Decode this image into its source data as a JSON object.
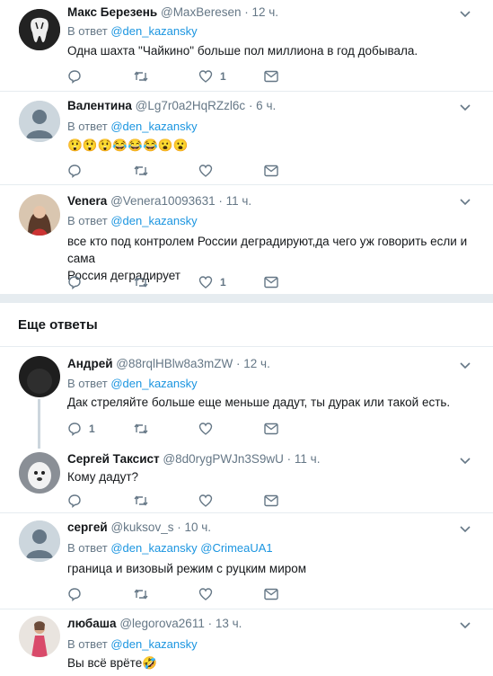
{
  "reply_prefix": "В ответ",
  "section_title": "Еще ответы",
  "tweets": [
    {
      "name": "Макс Березень",
      "handle": "@MaxBeresen",
      "time": "· 12 ч.",
      "reply_to": [
        "@den_kazansky"
      ],
      "text": [
        "Одна шахта \"Чайкино\" больше пол миллиона в год добывала."
      ],
      "reply_count": "",
      "like_count": "1",
      "avatar": "tooth-logo"
    },
    {
      "name": "Валентина",
      "handle": "@Lg7r0a2HqRZzl6c",
      "time": "· 6 ч.",
      "reply_to": [
        "@den_kazansky"
      ],
      "text": [
        "😲😲😲😂😂😂😮😮"
      ],
      "reply_count": "",
      "like_count": "",
      "avatar": "default"
    },
    {
      "name": "Venera",
      "handle": "@Venera10093631",
      "time": "· 11 ч.",
      "reply_to": [
        "@den_kazansky"
      ],
      "text": [
        "все кто под контролем России деградируют,да чего уж говорить если и сама",
        "Россия деградирует"
      ],
      "reply_count": "",
      "like_count": "1",
      "avatar": "photo-woman"
    },
    {
      "name": "Андрей",
      "handle": "@88rqlHBlw8a3mZW",
      "time": "· 12 ч.",
      "reply_to": [
        "@den_kazansky"
      ],
      "text": [
        "Дак стреляйте больше еще меньше дадут, ты дурак или такой есть."
      ],
      "reply_count": "1",
      "like_count": "",
      "avatar": "dark-photo"
    },
    {
      "name": "Сергей Таксист",
      "handle": "@8d0rygPWJn3S9wU",
      "time": "· 11 ч.",
      "reply_to": [],
      "text": [
        "Кому дадут?"
      ],
      "reply_count": "",
      "like_count": "",
      "avatar": "dog-photo"
    },
    {
      "name": "сергей",
      "handle": "@kuksov_s",
      "time": "· 10 ч.",
      "reply_to": [
        "@den_kazansky",
        "@CrimeaUA1"
      ],
      "text": [
        "граница и визовый режим с руцким миром"
      ],
      "reply_count": "",
      "like_count": "",
      "avatar": "default"
    },
    {
      "name": "любаша",
      "handle": "@legorova2611",
      "time": "· 13 ч.",
      "reply_to": [
        "@den_kazansky"
      ],
      "text": [
        "Вы всё врёте🤣"
      ],
      "reply_count": "",
      "like_count": "",
      "avatar": "photo-dress"
    }
  ]
}
